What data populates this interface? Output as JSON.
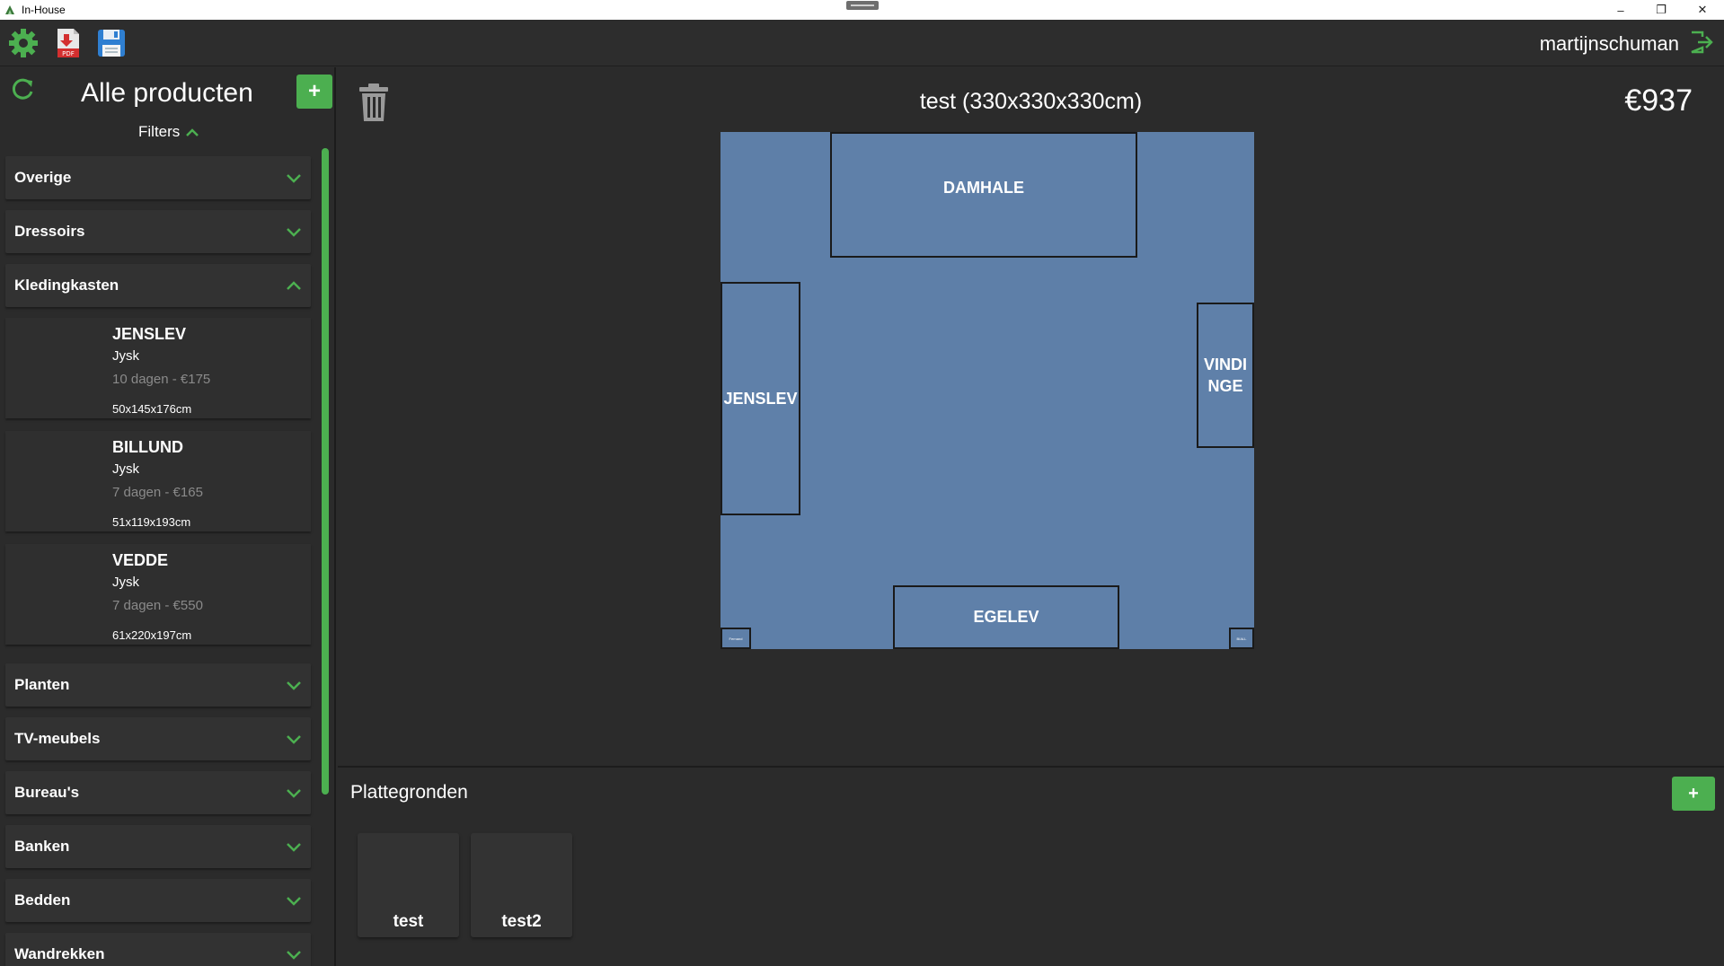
{
  "window": {
    "title": "In-House",
    "minimize": "–",
    "restore": "❐",
    "close": "✕"
  },
  "toolbar": {
    "username": "martijnschuman"
  },
  "sidebar": {
    "title": "Alle producten",
    "add_label": "+",
    "filters_label": "Filters",
    "categories_top": [
      {
        "label": "Overige",
        "expanded": false
      },
      {
        "label": "Dressoirs",
        "expanded": false
      },
      {
        "label": "Kledingkasten",
        "expanded": true
      }
    ],
    "products": [
      {
        "name": "JENSLEV",
        "brand": "Jysk",
        "delivery": "10 dagen - €175",
        "size": "50x145x176cm"
      },
      {
        "name": "BILLUND",
        "brand": "Jysk",
        "delivery": "7 dagen - €165",
        "size": "51x119x193cm"
      },
      {
        "name": "VEDDE",
        "brand": "Jysk",
        "delivery": "7 dagen - €550",
        "size": "61x220x197cm"
      }
    ],
    "categories_bottom": [
      {
        "label": "Planten",
        "expanded": false
      },
      {
        "label": "TV-meubels",
        "expanded": false
      },
      {
        "label": "Bureau's",
        "expanded": false
      },
      {
        "label": "Banken",
        "expanded": false
      },
      {
        "label": "Bedden",
        "expanded": false
      },
      {
        "label": "Wandrekken",
        "expanded": false
      }
    ]
  },
  "floorplan": {
    "title": "test (330x330x330cm)",
    "price": "€937",
    "items": {
      "damhale": "DAMHALE",
      "jenslev": "JENSLEV",
      "vindinge_1": "VINDI",
      "vindinge_2": "NGE",
      "egelev": "EGELEV",
      "small_left": "Fernand",
      "small_right": "BIALL"
    }
  },
  "plattegronden": {
    "title": "Plattegronden",
    "add_label": "+",
    "plans": [
      "test",
      "test2"
    ]
  },
  "colors": {
    "accent": "#4caf50",
    "room": "#5e7fa8",
    "background": "#2b2b2b"
  }
}
